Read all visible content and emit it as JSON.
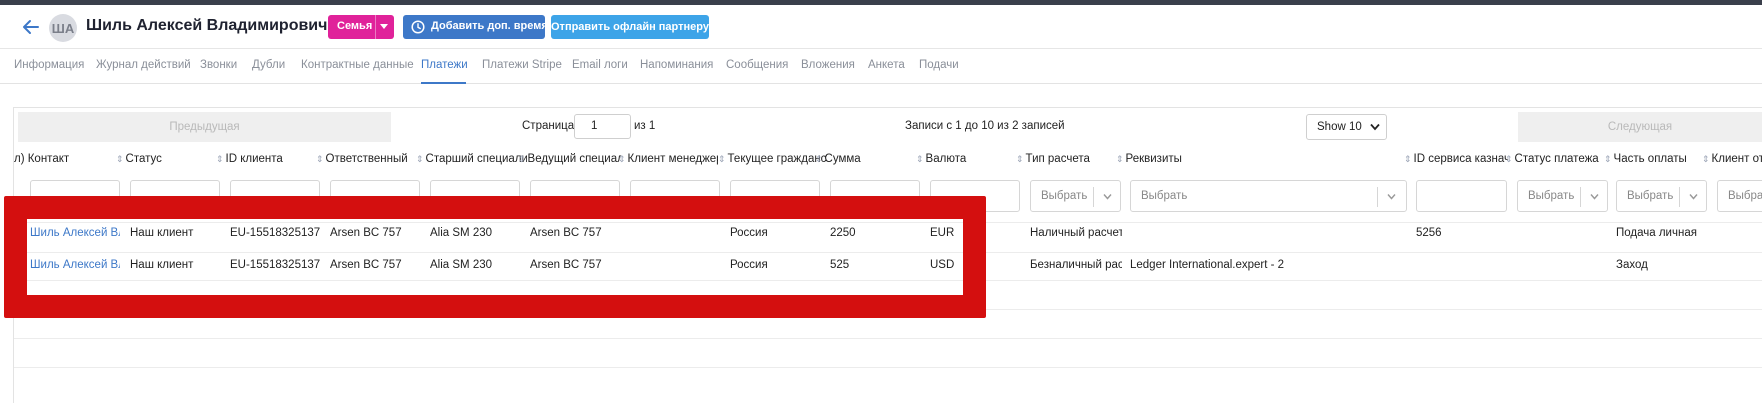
{
  "header": {
    "avatar_initials": "ША",
    "person_name": "Шиль Алексей Владимирович",
    "family_label": "Семья",
    "add_time_label": "Добавить доп. время",
    "send_partner_label": "Отправить офлайн партнеру"
  },
  "tabs": [
    {
      "label": "Информация"
    },
    {
      "label": "Журнал действий"
    },
    {
      "label": "Звонки"
    },
    {
      "label": "Дубли"
    },
    {
      "label": "Контрактные данные"
    },
    {
      "label": "Платежи",
      "active": true
    },
    {
      "label": "Платежи Stripe"
    },
    {
      "label": "Email логи"
    },
    {
      "label": "Напоминания"
    },
    {
      "label": "Сообщения"
    },
    {
      "label": "Вложения"
    },
    {
      "label": "Анкета"
    },
    {
      "label": "Подачи"
    }
  ],
  "pagination": {
    "prev_label": "Предыдущая",
    "page_label": "Страница",
    "page_value": "1",
    "of_label": "из 1",
    "records_text": "Записи с 1 до 10 из 2 записей",
    "show_label": "Show 10",
    "next_label": "Следующая"
  },
  "table": {
    "columns": [
      "л) Контакт",
      "Статус",
      "ID клиента",
      "Ответственный",
      "Старший специалист",
      "Ведущий специалист",
      "Клиент менеджер",
      "Текущее гражданство",
      "Сумма",
      "Валюта",
      "Тип расчета",
      "Реквизиты",
      "ID сервиса казначейства",
      "Статус платежа",
      "Часть оплаты",
      "Клиент от"
    ],
    "filter_placeholder": "Выбрать",
    "rows": [
      {
        "contact": "Шиль Алексей Владимирович",
        "status": "Наш клиент",
        "client_id": "EU-15518325137",
        "responsible": "Arsen BC 757",
        "senior": "Alia SM 230",
        "lead": "Arsen BC 757",
        "manager": "",
        "citizenship": "Россия",
        "amount": "2250",
        "currency": "EUR",
        "calc_type": "Наличный расчет",
        "requisites": "",
        "treasury_id": "5256",
        "pay_status": "",
        "pay_part": "Подача личная"
      },
      {
        "contact": "Шиль Алексей Владимирович",
        "status": "Наш клиент",
        "client_id": "EU-15518325137",
        "responsible": "Arsen BC 757",
        "senior": "Alia SM 230",
        "lead": "Arsen BC 757",
        "manager": "",
        "citizenship": "Россия",
        "amount": "525",
        "currency": "USD",
        "calc_type": "Безналичный расчет",
        "requisites": "Ledger International.expert - 2",
        "treasury_id": "",
        "pay_status": "",
        "pay_part": "Заход"
      }
    ]
  },
  "colors": {
    "accent": "#3d78c8",
    "family": "#e0229a",
    "send": "#3da4e8",
    "highlight": "#d40f0f"
  }
}
